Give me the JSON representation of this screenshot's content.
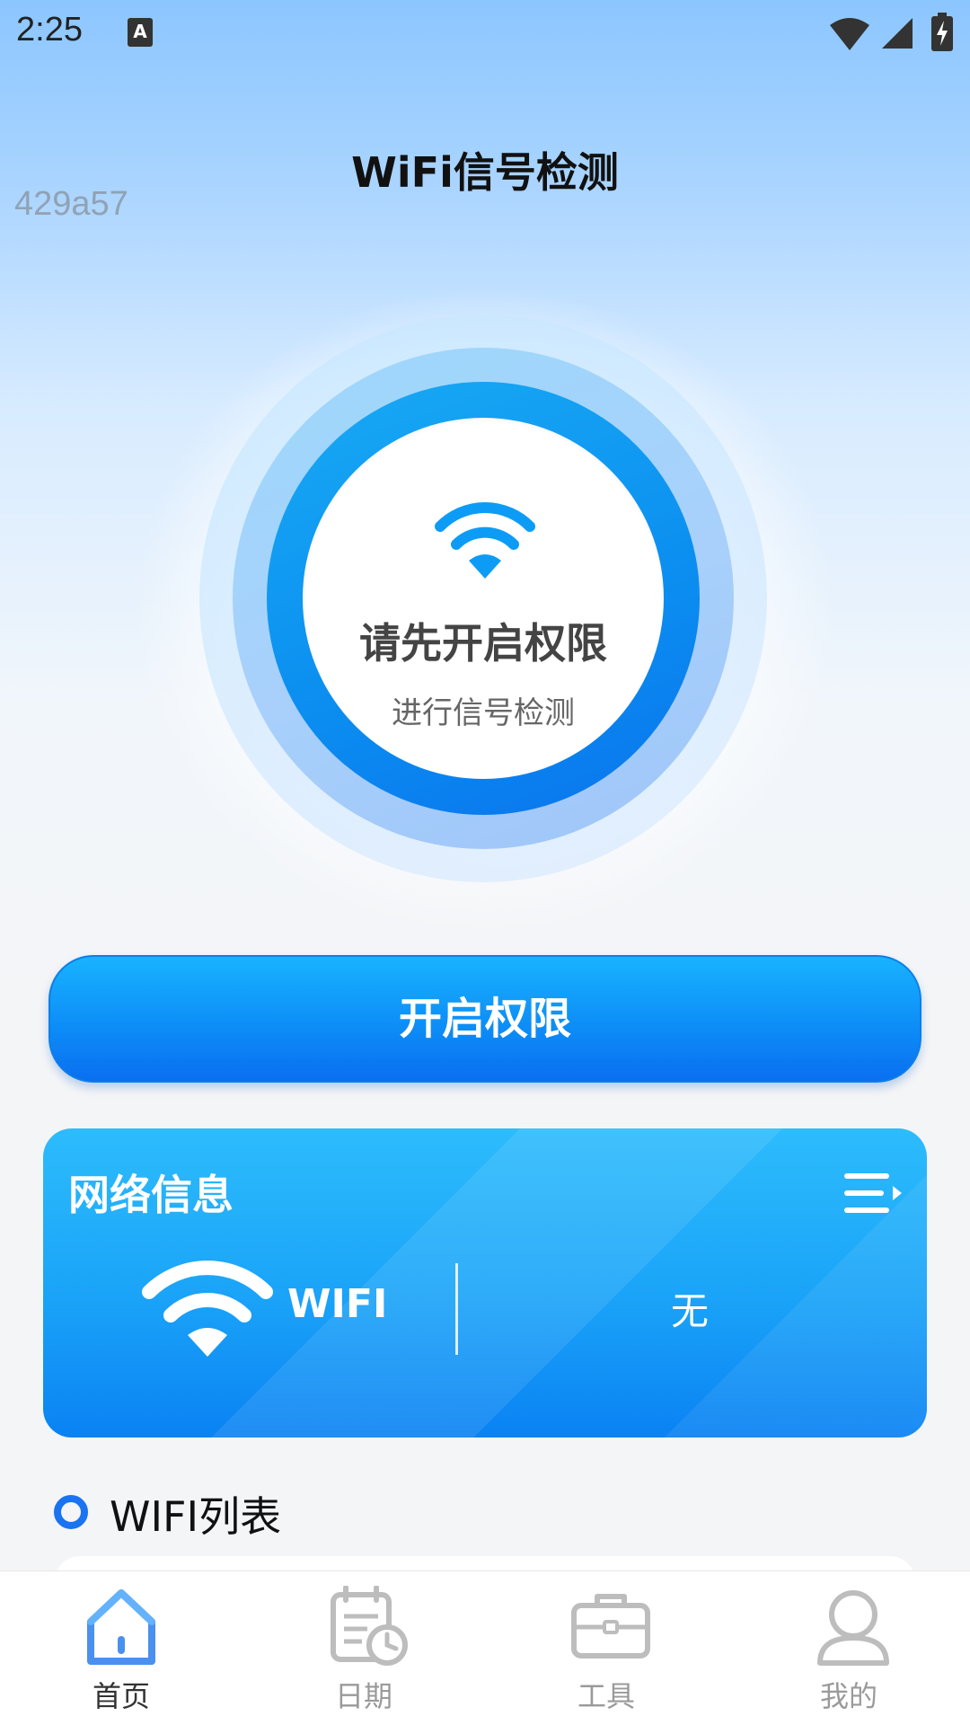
{
  "status_bar": {
    "time": "2:25",
    "notification_icon": "A",
    "icons": [
      "wifi-icon",
      "cell-signal-icon",
      "battery-charging-icon"
    ]
  },
  "debug_tag": "429a57",
  "header": {
    "title": "WiFi信号检测"
  },
  "scan_circle": {
    "title": "请先开启权限",
    "subtitle": "进行信号检测",
    "icon": "wifi-icon"
  },
  "primary_button": {
    "label": "开启权限"
  },
  "network_card": {
    "title": "网络信息",
    "menu_icon": "list-menu-icon",
    "type_label": "WIFI",
    "ssid_value": "无"
  },
  "wifi_list": {
    "title": "WIFI列表"
  },
  "bottom_nav": {
    "items": [
      {
        "label": "首页",
        "icon": "home-icon",
        "active": true
      },
      {
        "label": "日期",
        "icon": "calendar-clock-icon",
        "active": false
      },
      {
        "label": "工具",
        "icon": "toolbox-icon",
        "active": false
      },
      {
        "label": "我的",
        "icon": "user-icon",
        "active": false
      }
    ]
  },
  "colors": {
    "accent": "#0a82f3",
    "accent_light": "#2dbcfc",
    "nav_active": "#1a73f0",
    "nav_inactive": "#9a9a9a"
  }
}
